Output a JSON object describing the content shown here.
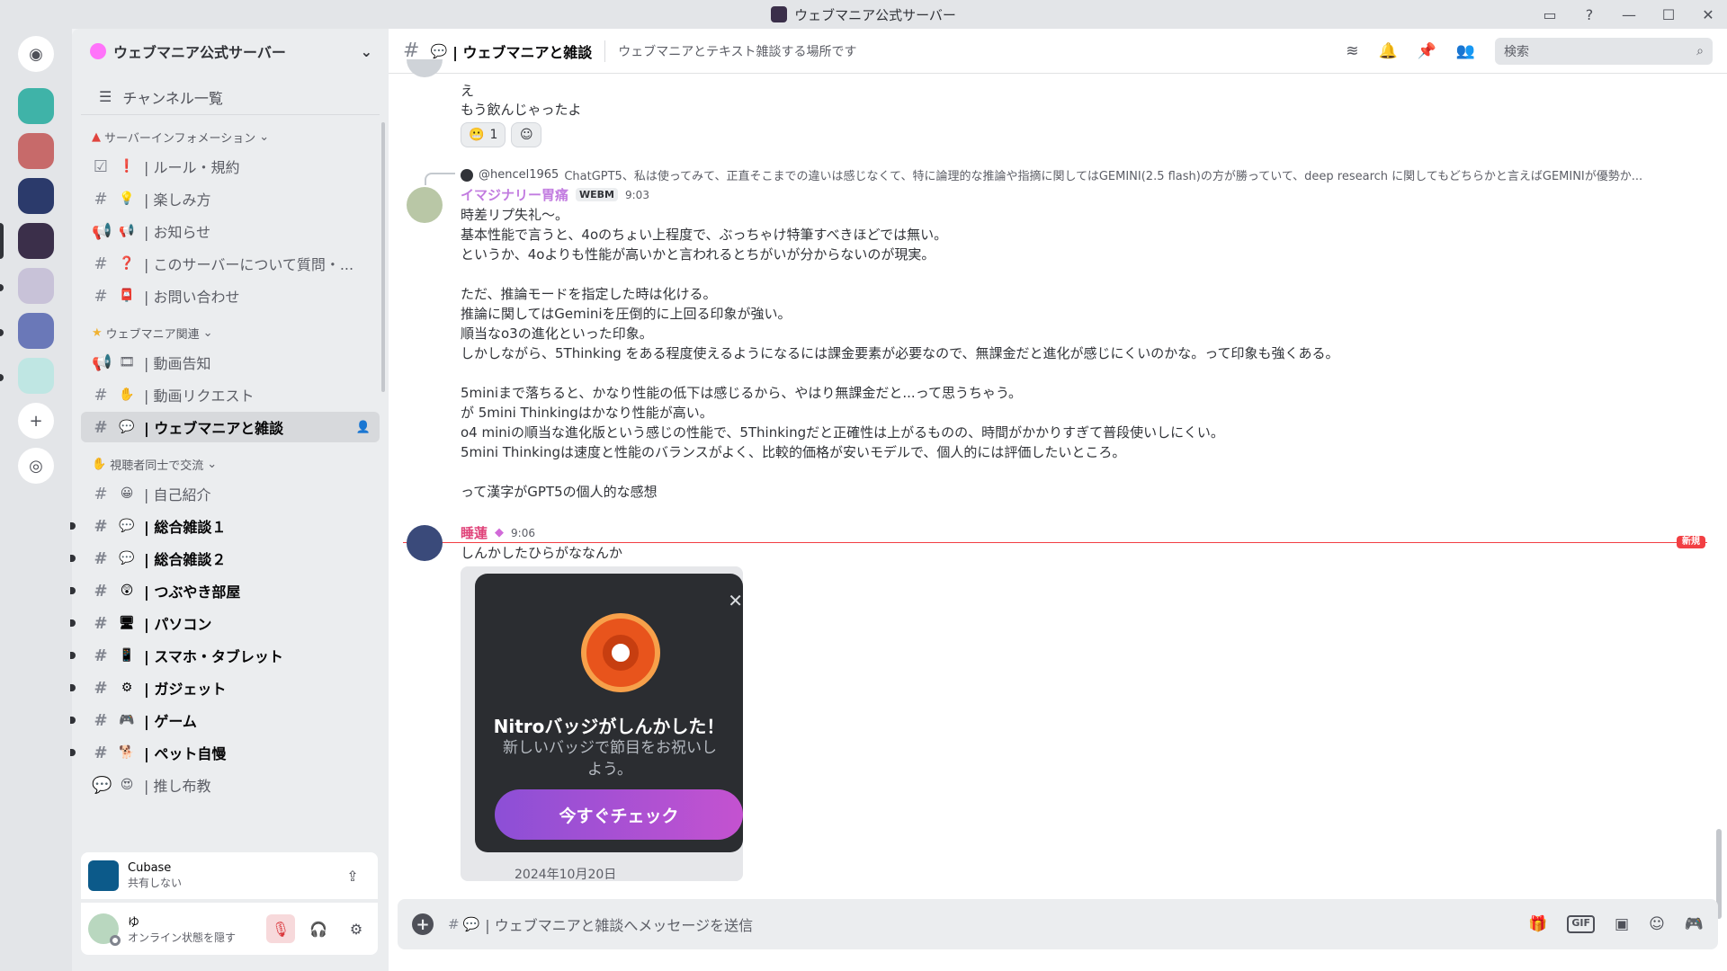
{
  "titlebar": {
    "title": "ウェブマニア公式サーバー"
  },
  "sidebar": {
    "server_name": "ウェブマニア公式サーバー",
    "browse_label": "チャンネル一覧",
    "categories": [
      {
        "name": "サーバーインフォメーション",
        "channels": [
          {
            "emoji": "❗",
            "name": "| ルール・規約"
          },
          {
            "emoji": "💡",
            "name": "| 楽しみ方"
          },
          {
            "emoji": "📢",
            "name": "| お知らせ"
          },
          {
            "emoji": "❓",
            "name": "| このサーバーについて質問・..."
          },
          {
            "emoji": "📮",
            "name": "| お問い合わせ"
          }
        ]
      },
      {
        "name": "ウェブマニア関連",
        "channels": [
          {
            "emoji": "🎞",
            "name": "| 動画告知"
          },
          {
            "emoji": "✋",
            "name": "| 動画リクエスト"
          },
          {
            "emoji": "💬",
            "name": "| ウェブマニアと雑談"
          }
        ]
      },
      {
        "name": "視聴者同士で交流",
        "channels": [
          {
            "emoji": "😀",
            "name": "| 自己紹介"
          },
          {
            "emoji": "💬",
            "name": "| 総合雑談１"
          },
          {
            "emoji": "💬",
            "name": "| 総合雑談２"
          },
          {
            "emoji": "😲",
            "name": "| つぶやき部屋"
          },
          {
            "emoji": "🖥",
            "name": "| パソコン"
          },
          {
            "emoji": "📱",
            "name": "| スマホ・タブレット"
          },
          {
            "emoji": "⚙",
            "name": "| ガジェット"
          },
          {
            "emoji": "🎮",
            "name": "| ゲーム"
          },
          {
            "emoji": "🐕",
            "name": "| ペット自慢"
          },
          {
            "emoji": "😍",
            "name": "| 推し布教"
          }
        ]
      }
    ]
  },
  "activity": {
    "app": "Cubase",
    "status": "共有しない"
  },
  "user": {
    "name": "ゆ",
    "status": "オンライン状態を隠す"
  },
  "chat": {
    "channel_name": "| ウェブマニアと雑談",
    "topic": "ウェブマニアとテキスト雑談する場所です",
    "search_placeholder": "検索",
    "msg1": {
      "line1": "え",
      "line2": "もう飲んじゃったよ",
      "reaction_count": "1"
    },
    "msg2": {
      "reply_user": "@hencel1965",
      "reply_text": "ChatGPT5、私は使ってみて、正直そこまでの違いは感じなくて、特に論理的な推論や指摘に関してはGEMINI(2.5 flash)の方が勝っていて、deep research に関してもどちらかと言えばGEMINIが優勢か...",
      "author": "イマジナリー胃痛",
      "tag": "WEBM",
      "time": "9:03",
      "lines": [
        "時差リプ失礼～。",
        "基本性能で言うと、4oのちょい上程度で、ぶっちゃけ特筆すべきほどでは無い。",
        "というか、4oよりも性能が高いかと言われるとちがいが分からないのが現実。",
        "",
        "ただ、推論モードを指定した時は化ける。",
        "推論に関してはGeminiを圧倒的に上回る印象が強い。",
        "順当なo3の進化といった印象。",
        "しかしながら、5Thinking をある程度使えるようになるには課金要素が必要なので、無課金だと進化が感じにくいのかな。って印象も強くある。",
        "",
        "5miniまで落ちると、かなり性能の低下は感じるから、やはり無課金だと...って思うちゃう。",
        "が 5mini Thinkingはかなり性能が高い。",
        "o4 miniの順当な進化版という感じの性能で、5Thinkingだと正確性は上がるものの、時間がかかりすぎて普段使いしにくい。",
        "5mini Thinkingは速度と性能のバランスがよく、比較的価格が安いモデルで、個人的には評価したいところ。",
        "",
        "って漢字がGPT5の個人的な感想"
      ]
    },
    "new_label": "新規",
    "msg3": {
      "author": "睡蓮",
      "time": "9:06",
      "text": "しんかしたひらがななんか",
      "popup_title": "Nitroバッジがしんかした！",
      "popup_sub": "新しいバッジで節目をお祝いしよう。",
      "popup_button": "今すぐチェック",
      "footer": "2024年10月20日"
    },
    "composer_placeholder": "| ウェブマニアと雑談へメッセージを送信"
  },
  "colors": {
    "author1": "#c27ce0",
    "author2": "#e0447a",
    "accent": "#5865f2",
    "new": "#f23f43"
  }
}
